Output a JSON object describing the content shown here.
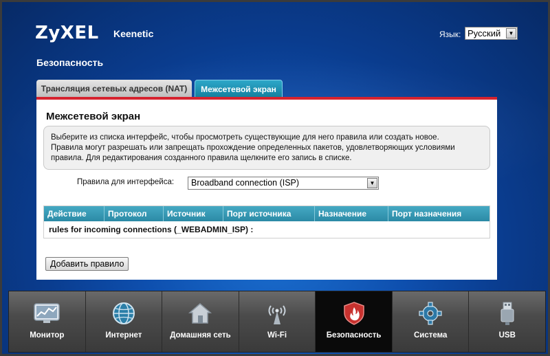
{
  "brand": {
    "logo": "ZyXEL",
    "product": "Keenetic"
  },
  "language": {
    "label": "Язык:",
    "selected": "Русский"
  },
  "page": {
    "title": "Безопасность"
  },
  "tabs": [
    {
      "label": "Трансляция сетевых адресов (NAT)",
      "active": false
    },
    {
      "label": "Межсетевой экран",
      "active": true
    }
  ],
  "panel": {
    "title": "Межсетевой экран",
    "info_lines": [
      "Выберите из списка интерфейс, чтобы просмотреть существующие для него правила или создать новое.",
      "Правила могут разрешать или запрещать прохождение определенных пакетов, удовлетворяющих условиями",
      "правила. Для редактирования созданного правила щелкните его запись в списке."
    ],
    "interface_label": "Правила для интерфейса:",
    "interface_selected": "Broadband connection (ISP)",
    "table": {
      "columns": [
        "Действие",
        "Протокол",
        "Источник",
        "Порт источника",
        "Назначение",
        "Порт назначения"
      ],
      "group_row": "rules for incoming connections (_WEBADMIN_ISP) :"
    },
    "add_button": "Добавить правило"
  },
  "dock": [
    {
      "label": "Монитор",
      "icon": "monitor-chart-icon"
    },
    {
      "label": "Интернет",
      "icon": "globe-icon"
    },
    {
      "label": "Домашняя сеть",
      "icon": "home-icon"
    },
    {
      "label": "Wi-Fi",
      "icon": "wifi-antenna-icon"
    },
    {
      "label": "Безопасность",
      "icon": "shield-flame-icon",
      "active": true
    },
    {
      "label": "Система",
      "icon": "gear-icon"
    },
    {
      "label": "USB",
      "icon": "usb-icon"
    }
  ],
  "colors": {
    "background": "#0e4fae",
    "accent_tab": "#1d8fb1",
    "red_stripe": "#d6232f",
    "table_header": "#3a9bb6",
    "dock": "#4b4b4b"
  }
}
